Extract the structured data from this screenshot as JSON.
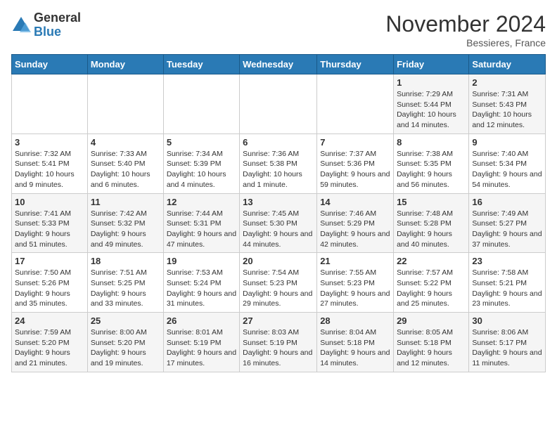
{
  "logo": {
    "general": "General",
    "blue": "Blue"
  },
  "header": {
    "month": "November 2024",
    "location": "Bessieres, France"
  },
  "days_of_week": [
    "Sunday",
    "Monday",
    "Tuesday",
    "Wednesday",
    "Thursday",
    "Friday",
    "Saturday"
  ],
  "weeks": [
    [
      {
        "day": "",
        "info": ""
      },
      {
        "day": "",
        "info": ""
      },
      {
        "day": "",
        "info": ""
      },
      {
        "day": "",
        "info": ""
      },
      {
        "day": "",
        "info": ""
      },
      {
        "day": "1",
        "info": "Sunrise: 7:29 AM\nSunset: 5:44 PM\nDaylight: 10 hours and 14 minutes."
      },
      {
        "day": "2",
        "info": "Sunrise: 7:31 AM\nSunset: 5:43 PM\nDaylight: 10 hours and 12 minutes."
      }
    ],
    [
      {
        "day": "3",
        "info": "Sunrise: 7:32 AM\nSunset: 5:41 PM\nDaylight: 10 hours and 9 minutes."
      },
      {
        "day": "4",
        "info": "Sunrise: 7:33 AM\nSunset: 5:40 PM\nDaylight: 10 hours and 6 minutes."
      },
      {
        "day": "5",
        "info": "Sunrise: 7:34 AM\nSunset: 5:39 PM\nDaylight: 10 hours and 4 minutes."
      },
      {
        "day": "6",
        "info": "Sunrise: 7:36 AM\nSunset: 5:38 PM\nDaylight: 10 hours and 1 minute."
      },
      {
        "day": "7",
        "info": "Sunrise: 7:37 AM\nSunset: 5:36 PM\nDaylight: 9 hours and 59 minutes."
      },
      {
        "day": "8",
        "info": "Sunrise: 7:38 AM\nSunset: 5:35 PM\nDaylight: 9 hours and 56 minutes."
      },
      {
        "day": "9",
        "info": "Sunrise: 7:40 AM\nSunset: 5:34 PM\nDaylight: 9 hours and 54 minutes."
      }
    ],
    [
      {
        "day": "10",
        "info": "Sunrise: 7:41 AM\nSunset: 5:33 PM\nDaylight: 9 hours and 51 minutes."
      },
      {
        "day": "11",
        "info": "Sunrise: 7:42 AM\nSunset: 5:32 PM\nDaylight: 9 hours and 49 minutes."
      },
      {
        "day": "12",
        "info": "Sunrise: 7:44 AM\nSunset: 5:31 PM\nDaylight: 9 hours and 47 minutes."
      },
      {
        "day": "13",
        "info": "Sunrise: 7:45 AM\nSunset: 5:30 PM\nDaylight: 9 hours and 44 minutes."
      },
      {
        "day": "14",
        "info": "Sunrise: 7:46 AM\nSunset: 5:29 PM\nDaylight: 9 hours and 42 minutes."
      },
      {
        "day": "15",
        "info": "Sunrise: 7:48 AM\nSunset: 5:28 PM\nDaylight: 9 hours and 40 minutes."
      },
      {
        "day": "16",
        "info": "Sunrise: 7:49 AM\nSunset: 5:27 PM\nDaylight: 9 hours and 37 minutes."
      }
    ],
    [
      {
        "day": "17",
        "info": "Sunrise: 7:50 AM\nSunset: 5:26 PM\nDaylight: 9 hours and 35 minutes."
      },
      {
        "day": "18",
        "info": "Sunrise: 7:51 AM\nSunset: 5:25 PM\nDaylight: 9 hours and 33 minutes."
      },
      {
        "day": "19",
        "info": "Sunrise: 7:53 AM\nSunset: 5:24 PM\nDaylight: 9 hours and 31 minutes."
      },
      {
        "day": "20",
        "info": "Sunrise: 7:54 AM\nSunset: 5:23 PM\nDaylight: 9 hours and 29 minutes."
      },
      {
        "day": "21",
        "info": "Sunrise: 7:55 AM\nSunset: 5:23 PM\nDaylight: 9 hours and 27 minutes."
      },
      {
        "day": "22",
        "info": "Sunrise: 7:57 AM\nSunset: 5:22 PM\nDaylight: 9 hours and 25 minutes."
      },
      {
        "day": "23",
        "info": "Sunrise: 7:58 AM\nSunset: 5:21 PM\nDaylight: 9 hours and 23 minutes."
      }
    ],
    [
      {
        "day": "24",
        "info": "Sunrise: 7:59 AM\nSunset: 5:20 PM\nDaylight: 9 hours and 21 minutes."
      },
      {
        "day": "25",
        "info": "Sunrise: 8:00 AM\nSunset: 5:20 PM\nDaylight: 9 hours and 19 minutes."
      },
      {
        "day": "26",
        "info": "Sunrise: 8:01 AM\nSunset: 5:19 PM\nDaylight: 9 hours and 17 minutes."
      },
      {
        "day": "27",
        "info": "Sunrise: 8:03 AM\nSunset: 5:19 PM\nDaylight: 9 hours and 16 minutes."
      },
      {
        "day": "28",
        "info": "Sunrise: 8:04 AM\nSunset: 5:18 PM\nDaylight: 9 hours and 14 minutes."
      },
      {
        "day": "29",
        "info": "Sunrise: 8:05 AM\nSunset: 5:18 PM\nDaylight: 9 hours and 12 minutes."
      },
      {
        "day": "30",
        "info": "Sunrise: 8:06 AM\nSunset: 5:17 PM\nDaylight: 9 hours and 11 minutes."
      }
    ]
  ]
}
